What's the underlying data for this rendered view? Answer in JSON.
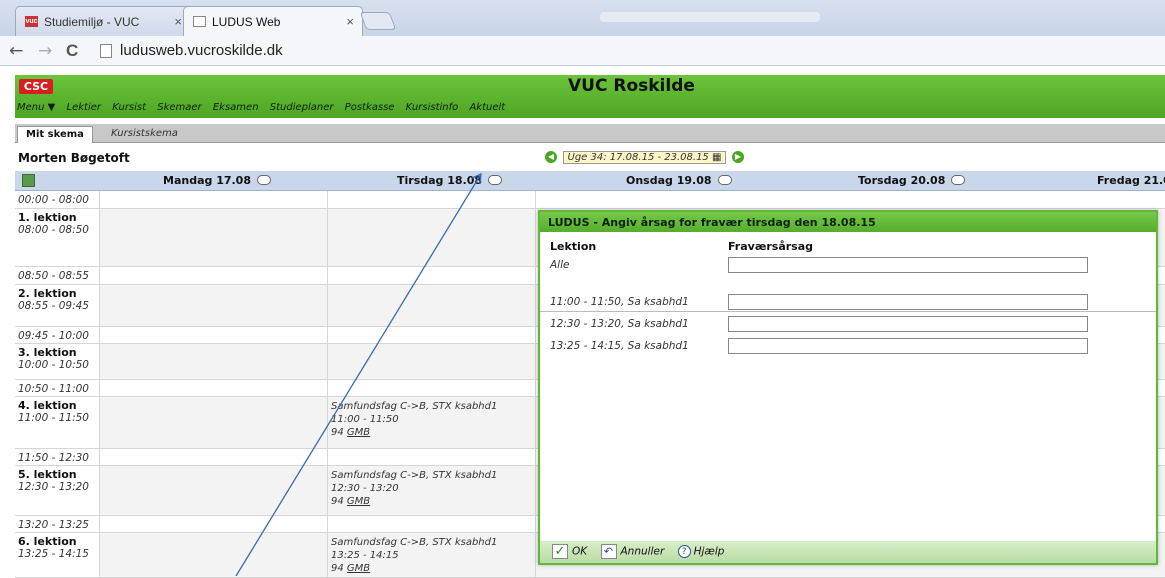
{
  "browser": {
    "tabs": [
      {
        "label": "Studiemiljø - VUC",
        "favicon": "vuc-icon"
      },
      {
        "label": "LUDUS Web",
        "favicon": "page-icon"
      }
    ],
    "tab_close": "×",
    "url": "ludusweb.vucroskilde.dk",
    "back_glyph": "←",
    "forward_glyph": "→",
    "reload_glyph": "C"
  },
  "app": {
    "logo": "CSC",
    "title": "VUC Roskilde",
    "menu_items": [
      "Menu ▼",
      "Lektier",
      "Kursist",
      "Skemaer",
      "Eksamen",
      "Studieplaner",
      "Postkasse",
      "Kursistinfo",
      "Aktuelt"
    ],
    "subtabs": {
      "active": "Mit skema",
      "other": "Kursistskema"
    },
    "student_name": "Morten Bøgetoft",
    "week": "Uge 34: 17.08.15 - 23.08.15"
  },
  "schedule": {
    "days": [
      "Mandag 17.08",
      "Tirsdag 18.08",
      "Onsdag 19.08",
      "Torsdag 20.08",
      "Fredag 21.0"
    ],
    "rows": [
      {
        "kind": "gap",
        "time": "00:00 - 08:00"
      },
      {
        "kind": "lesson",
        "name": "1. lektion",
        "time": "08:00 - 08:50"
      },
      {
        "kind": "gap",
        "time": "08:50 - 08:55"
      },
      {
        "kind": "lesson",
        "name": "2. lektion",
        "time": "08:55 - 09:45"
      },
      {
        "kind": "gap",
        "time": "09:45 - 10:00"
      },
      {
        "kind": "lesson",
        "name": "3. lektion",
        "time": "10:00 - 10:50"
      },
      {
        "kind": "gap",
        "time": "10:50 - 11:00"
      },
      {
        "kind": "lesson",
        "name": "4. lektion",
        "time": "11:00 - 11:50",
        "event": {
          "subject": "Samfundsfag C->B, STX ksabhd1",
          "time": "11:00 - 11:50",
          "room": "94",
          "teacher": "GMB"
        }
      },
      {
        "kind": "gap",
        "time": "11:50 - 12:30"
      },
      {
        "kind": "lesson",
        "name": "5. lektion",
        "time": "12:30 - 13:20",
        "event": {
          "subject": "Samfundsfag C->B, STX ksabhd1",
          "time": "12:30 - 13:20",
          "room": "94",
          "teacher": "GMB"
        }
      },
      {
        "kind": "gap",
        "time": "13:20 - 13:25"
      },
      {
        "kind": "lesson",
        "name": "6. lektion",
        "time": "13:25 - 14:15",
        "event": {
          "subject": "Samfundsfag C->B, STX ksabhd1",
          "time": "13:25 - 14:15",
          "room": "94",
          "teacher": "GMB"
        }
      }
    ]
  },
  "dialog": {
    "title": "LUDUS - Angiv årsag for fravær tirsdag den 18.08.15",
    "col_lesson": "Lektion",
    "col_reason": "Fraværsårsag",
    "all_label": "Alle",
    "entries": [
      {
        "label": "11:00 - 11:50, Sa ksabhd1",
        "value": ""
      },
      {
        "label": "12:30 - 13:20, Sa ksabhd1",
        "value": ""
      },
      {
        "label": "13:25 - 14:15, Sa ksabhd1",
        "value": ""
      }
    ],
    "ok": "OK",
    "cancel": "Annuller",
    "help": "Hjælp"
  },
  "colors": {
    "brand_green": "#56ad2c",
    "logo_red": "#d62020",
    "header_blue": "#c9d7ea",
    "arrow": "#3a6ab0"
  }
}
